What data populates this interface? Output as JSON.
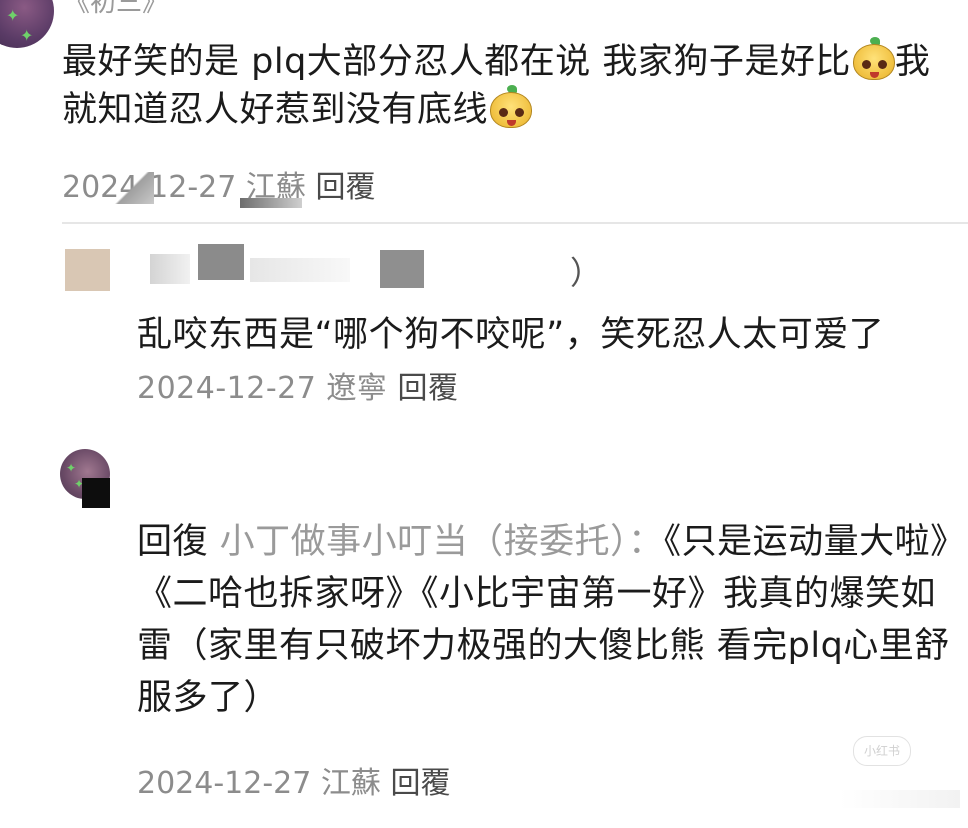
{
  "comments": [
    {
      "name_fragment": "《初三》",
      "text_part1": "最好笑的是 plq大部分忍人都在说 我家狗子是好比",
      "text_part2": "我就知道忍人好惹到没有底线",
      "date": "2024-12-27",
      "location": "江蘇",
      "reply_label": "回覆"
    },
    {
      "paren_fragment": "）",
      "text": "乱咬东西是“哪个狗不咬呢”，笑死忍人太可爱了",
      "date": "2024-12-27",
      "location": "遼寧",
      "reply_label": "回覆"
    },
    {
      "reply_prefix": "回復",
      "mention": "小丁做事小叮当（接委托）：",
      "text": "《只是运动量大啦》《二哈也拆家呀》《小比宇宙第一好》我真的爆笑如雷（家里有只破坏力极强的大傻比熊 看完plq心里舒服多了）",
      "date": "2024-12-27",
      "location": "江蘇",
      "reply_label": "回覆"
    }
  ],
  "watermark": "小红书",
  "icons": {
    "emoji": "cute-mango-face-emoji",
    "avatar_decoration": "green-sparkle-icon"
  }
}
